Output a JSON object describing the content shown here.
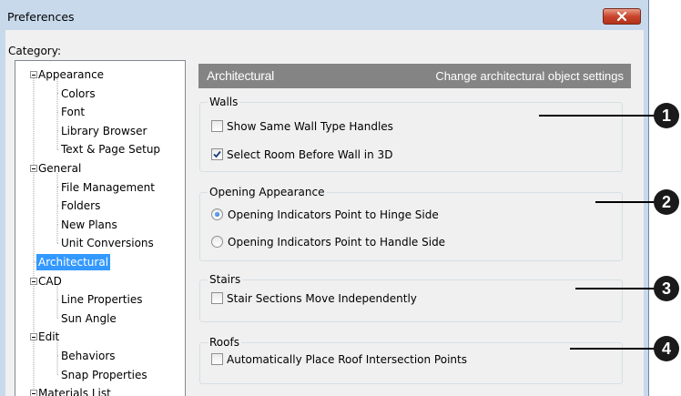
{
  "window": {
    "title": "Preferences"
  },
  "category_label": "Category:",
  "tree": [
    {
      "label": "Appearance",
      "level": 0,
      "expandable": true
    },
    {
      "label": "Colors",
      "level": 1
    },
    {
      "label": "Font",
      "level": 1
    },
    {
      "label": "Library Browser",
      "level": 1
    },
    {
      "label": "Text & Page Setup",
      "level": 1
    },
    {
      "label": "General",
      "level": 0,
      "expandable": true
    },
    {
      "label": "File Management",
      "level": 1
    },
    {
      "label": "Folders",
      "level": 1
    },
    {
      "label": "New Plans",
      "level": 1
    },
    {
      "label": "Unit Conversions",
      "level": 1
    },
    {
      "label": "Architectural",
      "level": 0,
      "selected": true
    },
    {
      "label": "CAD",
      "level": 0,
      "expandable": true
    },
    {
      "label": "Line Properties",
      "level": 1
    },
    {
      "label": "Sun Angle",
      "level": 1
    },
    {
      "label": "Edit",
      "level": 0,
      "expandable": true
    },
    {
      "label": "Behaviors",
      "level": 1
    },
    {
      "label": "Snap Properties",
      "level": 1
    },
    {
      "label": "Materials List",
      "level": 0,
      "expandable": true
    }
  ],
  "panel": {
    "title": "Architectural",
    "description": "Change architectural object settings",
    "walls": {
      "label": "Walls",
      "show_same_wall_type_handles": {
        "label": "Show Same Wall Type Handles",
        "checked": false
      },
      "select_room_before_wall": {
        "label": "Select Room Before Wall in 3D",
        "checked": true
      }
    },
    "opening": {
      "label": "Opening Appearance",
      "hinge": {
        "label": "Opening Indicators Point to Hinge Side",
        "selected": true
      },
      "handle": {
        "label": "Opening Indicators Point to Handle Side",
        "selected": false
      }
    },
    "stairs": {
      "label": "Stairs",
      "move_independently": {
        "label": "Stair Sections Move Independently",
        "checked": false
      }
    },
    "roofs": {
      "label": "Roofs",
      "auto_intersection": {
        "label": "Automatically Place Roof Intersection Points",
        "checked": false
      }
    }
  },
  "callouts": [
    "1",
    "2",
    "3",
    "4"
  ],
  "colors": {
    "accent_selection": "#3399ff",
    "header_bar": "#848484",
    "close_button": "#c8452c"
  },
  "icons": {
    "close": "close-x-icon",
    "check": "checkmark-icon"
  }
}
